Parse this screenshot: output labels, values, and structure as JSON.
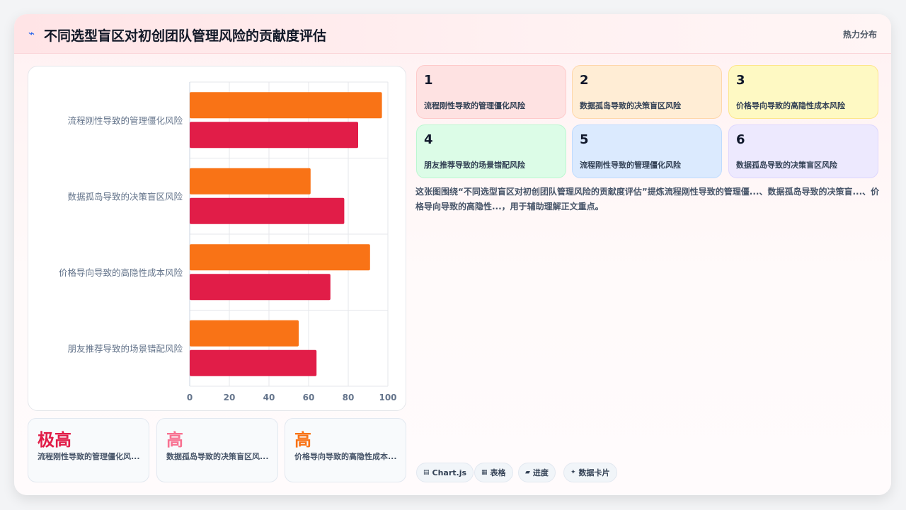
{
  "header": {
    "icon": "lightning-icon",
    "title": "不同选型盲区对初创团队管理风险的贡献度评估",
    "tag": "热力分布"
  },
  "chart_data": {
    "type": "bar",
    "orientation": "horizontal",
    "categories": [
      "流程刚性导致的管理僵化风险",
      "数据孤岛导致的决策盲区风险",
      "价格导向导致的高隐性成本风险",
      "朋友推荐导致的场景错配风险"
    ],
    "series": [
      {
        "color": "#f97316",
        "values": [
          97,
          61,
          91,
          55
        ]
      },
      {
        "color": "#e11d48",
        "values": [
          85,
          78,
          71,
          64
        ]
      }
    ],
    "xlim": [
      0,
      100
    ],
    "xticks": [
      "0",
      "20",
      "40",
      "60",
      "80",
      "100"
    ],
    "grid": true,
    "legend": "none"
  },
  "stats": [
    {
      "level": "极高",
      "desc": "流程刚性导致的管理僵化风...",
      "color": "#e11d48"
    },
    {
      "level": "高",
      "desc": "数据孤岛导致的决策盲区风...",
      "color": "#f87191"
    },
    {
      "level": "高",
      "desc": "价格导向导致的高隐性成本...",
      "color": "#f97316"
    }
  ],
  "tiles": [
    {
      "num": "1",
      "label": "流程刚性导致的管理僵化风险",
      "bg": "#fee2e2",
      "border": "#fecaca"
    },
    {
      "num": "2",
      "label": "数据孤岛导致的决策盲区风险",
      "bg": "#ffedd5",
      "border": "#fed7aa"
    },
    {
      "num": "3",
      "label": "价格导向导致的高隐性成本风险",
      "bg": "#fef9c3",
      "border": "#fde68a"
    },
    {
      "num": "4",
      "label": "朋友推荐导致的场景错配风险",
      "bg": "#dcfce7",
      "border": "#bbf7d0"
    },
    {
      "num": "5",
      "label": "流程刚性导致的管理僵化风险",
      "bg": "#dbeafe",
      "border": "#bfdbfe"
    },
    {
      "num": "6",
      "label": "数据孤岛导致的决策盲区风险",
      "bg": "#ede9fe",
      "border": "#ddd6fe"
    }
  ],
  "description": "这张图围绕“不同选型盲区对初创团队管理风险的贡献度评估”提炼流程刚性导致的管理僵...、数据孤岛导致的决策盲...、价格导向导致的高隐性...，用于辅助理解正文重点。",
  "chips": [
    {
      "icon": "chart-icon",
      "glyph": "▤",
      "label": "Chart.js"
    },
    {
      "icon": "table-icon",
      "glyph": "▦",
      "label": "表格"
    },
    {
      "icon": "progress-icon",
      "glyph": "▰",
      "label": "进度"
    },
    {
      "icon": "sparkle-icon",
      "glyph": "✦",
      "label": "数据卡片"
    }
  ]
}
